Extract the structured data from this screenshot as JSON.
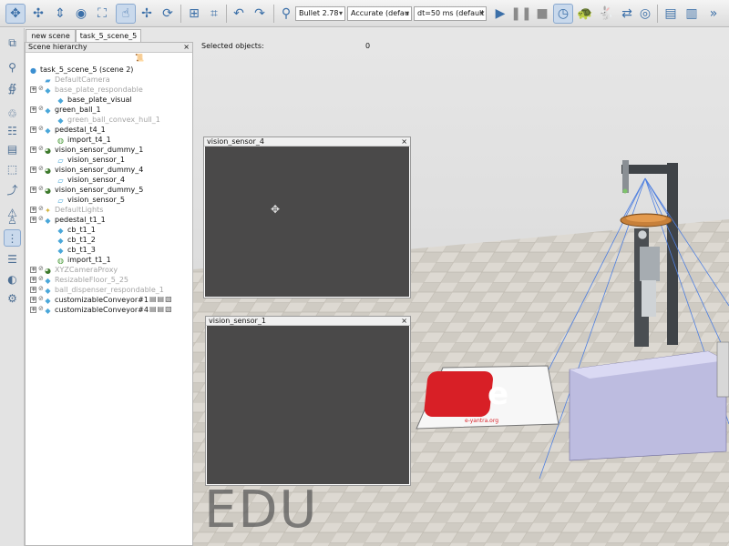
{
  "toolbar": {
    "engine": "Bullet 2.78",
    "accuracy": "Accurate (defau",
    "timestep": "dt=50 ms (default",
    "icons": [
      "camera-pan-icon",
      "camera-rotate-icon",
      "camera-shift-icon",
      "camera-angle-icon",
      "fit-view-icon",
      "click-select-icon",
      "object-shift-icon",
      "object-rotate-icon",
      "assemble-icon",
      "transfer-dna-icon",
      "undo-icon",
      "redo-icon",
      "dynamics-icon",
      "play-icon",
      "pause-icon",
      "stop-icon",
      "realtime-icon",
      "thread-icon",
      "visualization-icon",
      "page-selector-icon",
      "scene-selector-icon"
    ]
  },
  "tabs": [
    {
      "label": "new scene",
      "active": false
    },
    {
      "label": "task_5_scene_5",
      "active": true
    }
  ],
  "hierarchy": {
    "title": "Scene hierarchy",
    "close": "×",
    "rows": [
      {
        "label": "task_5_scene_5 (scene 2)",
        "icon": "scene-icon",
        "dim": false
      },
      {
        "label": "DefaultCamera",
        "icon": "camera-icon",
        "dim": true
      },
      {
        "label": "base_plate_respondable",
        "icon": "shape-icon",
        "dim": true
      },
      {
        "label": "base_plate_visual",
        "icon": "shape-icon",
        "dim": false
      },
      {
        "label": "green_ball_1",
        "icon": "shape-icon",
        "dim": false
      },
      {
        "label": "green_ball_convex_hull_1",
        "icon": "shape-icon",
        "dim": true
      },
      {
        "label": "pedestal_t4_1",
        "icon": "shape-icon",
        "dim": false
      },
      {
        "label": "import_t4_1",
        "icon": "model-icon",
        "dim": false
      },
      {
        "label": "vision_sensor_dummy_1",
        "icon": "dummy-icon",
        "dim": false
      },
      {
        "label": "vision_sensor_1",
        "icon": "vision-sensor-icon",
        "dim": false
      },
      {
        "label": "vision_sensor_dummy_4",
        "icon": "dummy-icon",
        "dim": false
      },
      {
        "label": "vision_sensor_4",
        "icon": "vision-sensor-icon",
        "dim": false
      },
      {
        "label": "vision_sensor_dummy_5",
        "icon": "dummy-icon",
        "dim": false
      },
      {
        "label": "vision_sensor_5",
        "icon": "vision-sensor-icon",
        "dim": false
      },
      {
        "label": "DefaultLights",
        "icon": "light-icon",
        "dim": true
      },
      {
        "label": "pedestal_t1_1",
        "icon": "shape-icon",
        "dim": false
      },
      {
        "label": "cb_t1_1",
        "icon": "shape-icon",
        "dim": false
      },
      {
        "label": "cb_t1_2",
        "icon": "shape-icon",
        "dim": false
      },
      {
        "label": "cb_t1_3",
        "icon": "shape-icon",
        "dim": false
      },
      {
        "label": "import_t1_1",
        "icon": "model-icon",
        "dim": false
      },
      {
        "label": "XYZCameraProxy",
        "icon": "dummy-icon",
        "dim": true
      },
      {
        "label": "ResizableFloor_5_25",
        "icon": "shape-icon",
        "dim": true
      },
      {
        "label": "ball_dispenser_respondable_1",
        "icon": "shape-icon",
        "dim": true
      },
      {
        "label": "customizableConveyor#1",
        "icon": "shape-icon",
        "dim": false
      },
      {
        "label": "customizableConveyor#4",
        "icon": "shape-icon",
        "dim": false
      }
    ]
  },
  "viewport": {
    "selected_label": "Selected objects:",
    "selected_count": "0",
    "watermark": "EDU",
    "logo_text": "e-yantra.org"
  },
  "floating": [
    {
      "title": "vision_sensor_4",
      "close": "×"
    },
    {
      "title": "vision_sensor_1",
      "close": "×"
    }
  ]
}
